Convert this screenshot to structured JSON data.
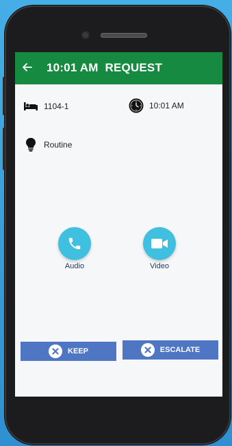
{
  "header": {
    "title": "10:01 AM  REQUEST"
  },
  "details": {
    "room": "1104-1",
    "time": "10:01 AM",
    "priority": "Routine"
  },
  "calls": {
    "audio_label": "Audio",
    "video_label": "Video"
  },
  "actions": {
    "keep_label": "KEEP",
    "escalate_label": "ESCALATE"
  },
  "colors": {
    "appbar": "#168a41",
    "call_button": "#40c0e0",
    "action_button": "#4f76c3"
  },
  "icons": [
    "back-arrow-icon",
    "bed-icon",
    "clock-icon",
    "lightbulb-icon",
    "phone-icon",
    "video-camera-icon",
    "close-circle-icon"
  ]
}
